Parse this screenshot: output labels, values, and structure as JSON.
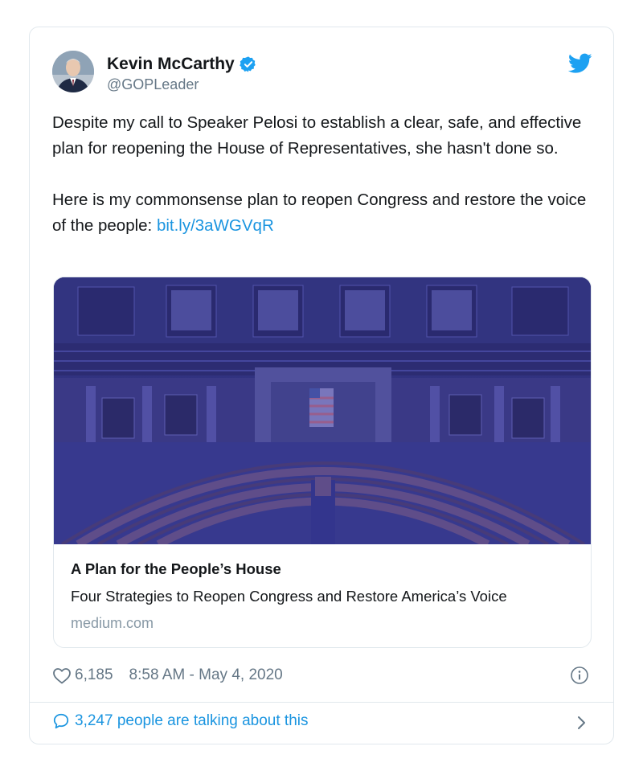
{
  "author": {
    "name": "Kevin McCarthy",
    "handle": "@GOPLeader",
    "verified": true
  },
  "tweet": {
    "paragraph1": "Despite my call to Speaker Pelosi to establish a clear, safe, and effective plan for reopening the House of Representatives, she hasn't done so.",
    "paragraph2_prefix": "Here is my commonsense plan to reopen Congress and restore the voice of the people: ",
    "paragraph2_link": "bit.ly/3aWGVqR"
  },
  "card": {
    "title": "A Plan for the People’s House",
    "description": "Four Strategies to Reopen Congress and Restore America’s Voice",
    "domain": "medium.com"
  },
  "meta": {
    "likes": "6,185",
    "timestamp": "8:58 AM - May 4, 2020"
  },
  "talking": {
    "label": "3,247 people are talking about this"
  },
  "icons": {
    "bird": "twitter-bird-icon",
    "verified": "verified-badge-icon",
    "heart": "heart-icon",
    "info": "info-icon",
    "bubble": "speech-bubble-icon",
    "chevron": "chevron-right-icon"
  },
  "colors": {
    "link": "#1b95e0",
    "secondary_text": "#657786",
    "border": "#e1e8ed",
    "image_tint": "#3b3f8f"
  }
}
